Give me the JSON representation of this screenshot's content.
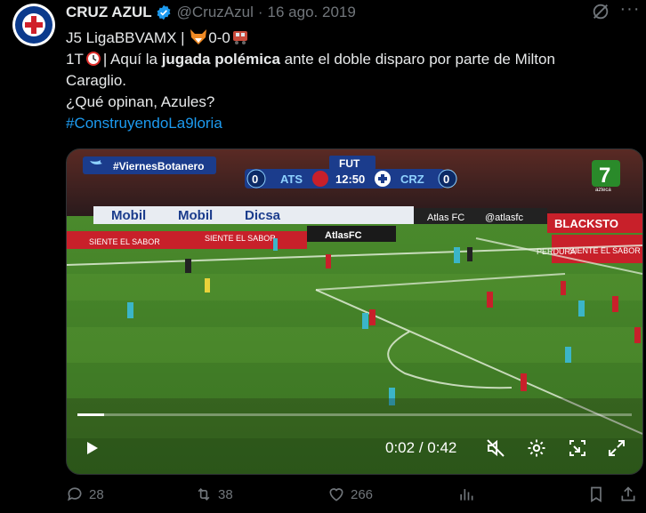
{
  "post": {
    "author_name": "CRUZ AZUL",
    "handle": "@CruzAzul",
    "separator": "·",
    "date": "16 ago. 2019",
    "avatar_icon": "cruz-azul-crest-icon",
    "verified_icon": "verified-badge-icon",
    "text": {
      "line1_prefix": "J5 LigaBBVAMX | ",
      "line1_score": "0-0",
      "line2_prefix": "1T",
      "line2_mid": "| Aquí la ",
      "line2_bold": "jugada polémica",
      "line2_rest": " ante el doble disparo por parte de Milton",
      "line3": "Caraglio.",
      "line4": "¿Qué opinan, Azules?",
      "hashtag": "#ConstruyendoLa9loria"
    }
  },
  "video": {
    "overlay_hashtag": "#ViernesBotanero",
    "score_home": "0",
    "team_home": "ATS",
    "clock": "12:50",
    "team_away": "CRZ",
    "score_away": "0",
    "scorebug_label": "FUT",
    "ads": [
      "Mobil",
      "Mobil",
      "Dicsa",
      "Atlas FC",
      "@atlasfc",
      "BLACKSTO",
      "SIENTE EL SABOR",
      "SIENTE EL SABOR",
      "SIENTE EL SABOR",
      "PERDURA",
      "AtlasFC"
    ],
    "channel_logo": "7",
    "channel_name": "azteca",
    "progress": 0.048,
    "time_current": "0:02",
    "time_sep": " / ",
    "time_total": "0:42"
  },
  "actions": {
    "replies": "28",
    "reposts": "38",
    "likes": "266"
  },
  "colors": {
    "accent": "#1d9bf0",
    "muted": "#71767b",
    "text": "#e7e9ea",
    "pitch": "#3f7a24"
  }
}
